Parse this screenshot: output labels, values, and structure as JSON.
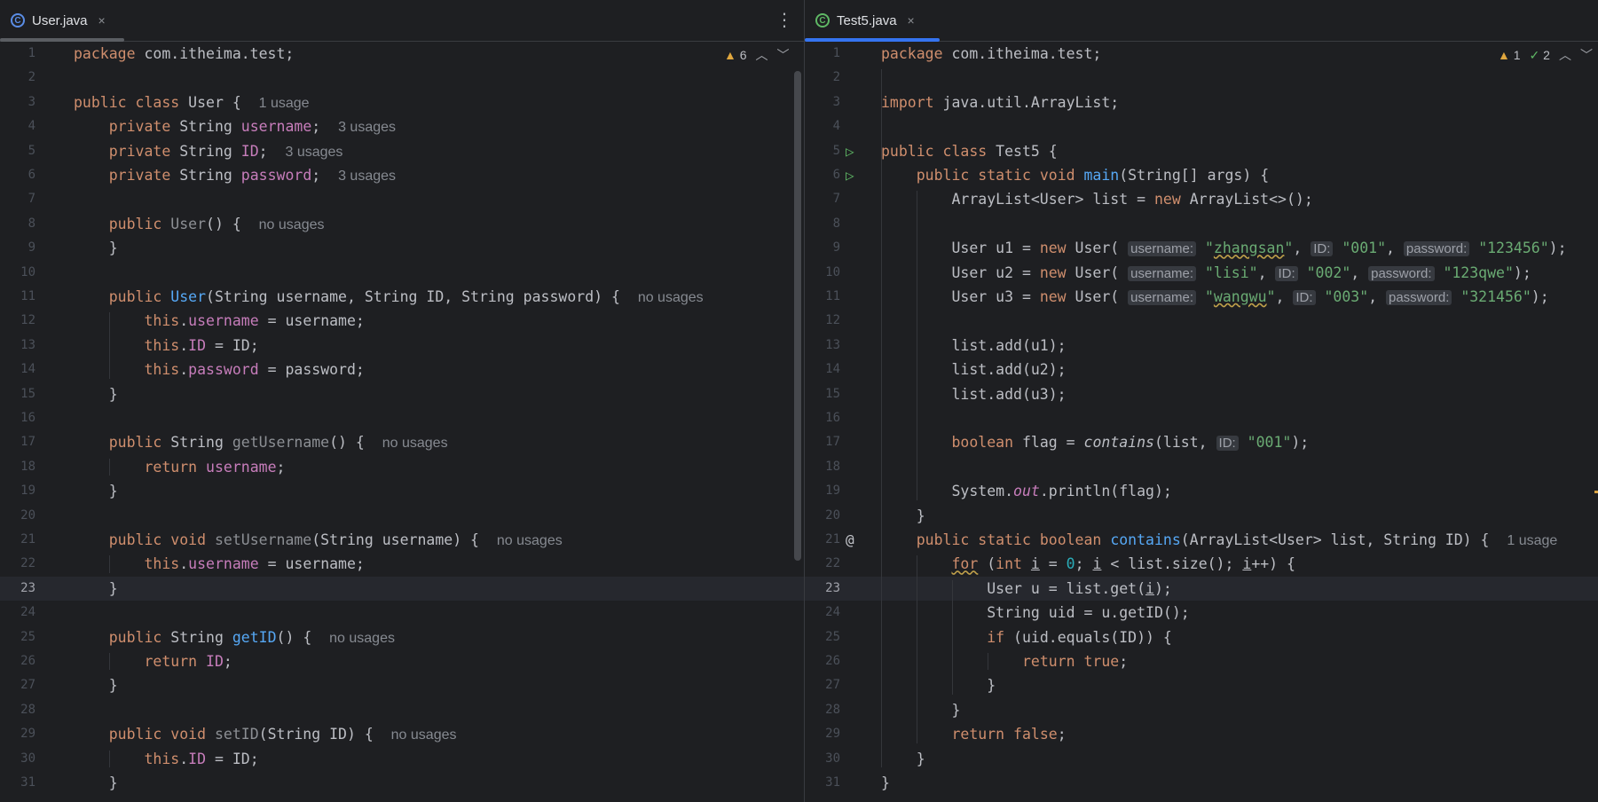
{
  "left": {
    "tab": {
      "icon": "class-icon",
      "name": "User.java",
      "close": "×"
    },
    "warnings": {
      "count": "6"
    },
    "lines": [
      "<span class=\"kw\">package</span> com.itheima.test;",
      "",
      "<span class=\"kw\">public class</span> User {  <span class=\"hint\">1 usage</span>",
      "    <span class=\"kw\">private</span> String <span class=\"field\">username</span>;  <span class=\"hint\">3 usages</span>",
      "    <span class=\"kw\">private</span> String <span class=\"field\">ID</span>;  <span class=\"hint\">3 usages</span>",
      "    <span class=\"kw\">private</span> String <span class=\"field\">password</span>;  <span class=\"hint\">3 usages</span>",
      "",
      "    <span class=\"kw\">public</span> <span class=\"dim\">User</span>() {  <span class=\"hint\">no usages</span>",
      "    }",
      "",
      "    <span class=\"kw\">public</span> <span class=\"fn\">User</span>(String username, String ID, String password) {  <span class=\"hint\">no usages</span>",
      "        <span class=\"kw\">this</span>.<span class=\"field\">username</span> = username;",
      "        <span class=\"kw\">this</span>.<span class=\"field\">ID</span> = ID;",
      "        <span class=\"kw\">this</span>.<span class=\"field\">password</span> = password;",
      "    }",
      "",
      "    <span class=\"kw\">public</span> String <span class=\"dim\">getUsername</span>() {  <span class=\"hint\">no usages</span>",
      "        <span class=\"kw\">return</span> <span class=\"field\">username</span>;",
      "    }",
      "",
      "    <span class=\"kw\">public void</span> <span class=\"dim\">setUsername</span>(String username) {  <span class=\"hint\">no usages</span>",
      "        <span class=\"kw\">this</span>.<span class=\"field\">username</span> = username;",
      "    }",
      "",
      "    <span class=\"kw\">public</span> String <span class=\"fn\">getID</span>() {  <span class=\"hint\">no usages</span>",
      "        <span class=\"kw\">return</span> <span class=\"field\">ID</span>;",
      "    }",
      "",
      "    <span class=\"kw\">public void</span> <span class=\"dim\">setID</span>(String ID) {  <span class=\"hint\">no usages</span>",
      "        <span class=\"kw\">this</span>.<span class=\"field\">ID</span> = ID;",
      "    }"
    ],
    "current_line": 23
  },
  "right": {
    "tab": {
      "icon": "class-icon",
      "name": "Test5.java",
      "close": "×"
    },
    "warnings": {
      "count": "1",
      "checks": "2"
    },
    "lines": [
      "<span class=\"kw\">package</span> com.itheima.test;",
      "",
      "<span class=\"kw\">import</span> java.util.ArrayList;",
      "",
      "<span class=\"kw\">public class</span> Test5 {",
      "    <span class=\"kw\">public static void</span> <span class=\"fn\">main</span>(String[] args) {",
      "        ArrayList&lt;User&gt; list = <span class=\"kw\">new</span> ArrayList&lt;&gt;();",
      "",
      "        User u1 = <span class=\"kw\">new</span> User( <span class=\"param\">username:</span> <span class=\"str\">\"<span class=\"squiggle\">zhangsan</span>\"</span>, <span class=\"param\">ID:</span> <span class=\"str\">\"001\"</span>, <span class=\"param\">password:</span> <span class=\"str\">\"123456\"</span>);",
      "        User u2 = <span class=\"kw\">new</span> User( <span class=\"param\">username:</span> <span class=\"str\">\"lisi\"</span>, <span class=\"param\">ID:</span> <span class=\"str\">\"002\"</span>, <span class=\"param\">password:</span> <span class=\"str\">\"123qwe\"</span>);",
      "        User u3 = <span class=\"kw\">new</span> User( <span class=\"param\">username:</span> <span class=\"str\">\"<span class=\"squiggle\">wangwu</span>\"</span>, <span class=\"param\">ID:</span> <span class=\"str\">\"003\"</span>, <span class=\"param\">password:</span> <span class=\"str\">\"321456\"</span>);",
      "",
      "        list.add(u1);",
      "        list.add(u2);",
      "        list.add(u3);",
      "",
      "        <span class=\"kw\">boolean</span> flag = <span class=\"it\">contains</span>(list, <span class=\"param\">ID:</span> <span class=\"str\">\"001\"</span>);",
      "",
      "        System.<span class=\"field it\">out</span>.println(flag);",
      "    }",
      "    <span class=\"kw\">public static boolean</span> <span class=\"fn\">contains</span>(ArrayList&lt;User&gt; list, String ID) {  <span class=\"hint\">1 usage</span>",
      "        <span class=\"kw squiggle\">for</span> (<span class=\"kw\">int</span> <span class=\"uline\">i</span> = <span class=\"num\">0</span>; <span class=\"uline\">i</span> &lt; list.size(); <span class=\"uline\">i</span>++) {",
      "            User u = list.get(<span class=\"uline\">i</span>);",
      "            String uid = u.getID();",
      "            <span class=\"kw\">if</span> (uid.equals(ID)) {",
      "                <span class=\"kw\">return true</span>;",
      "            }",
      "        }",
      "        <span class=\"kw\">return false</span>;",
      "    }",
      "}"
    ],
    "current_line": 23
  }
}
